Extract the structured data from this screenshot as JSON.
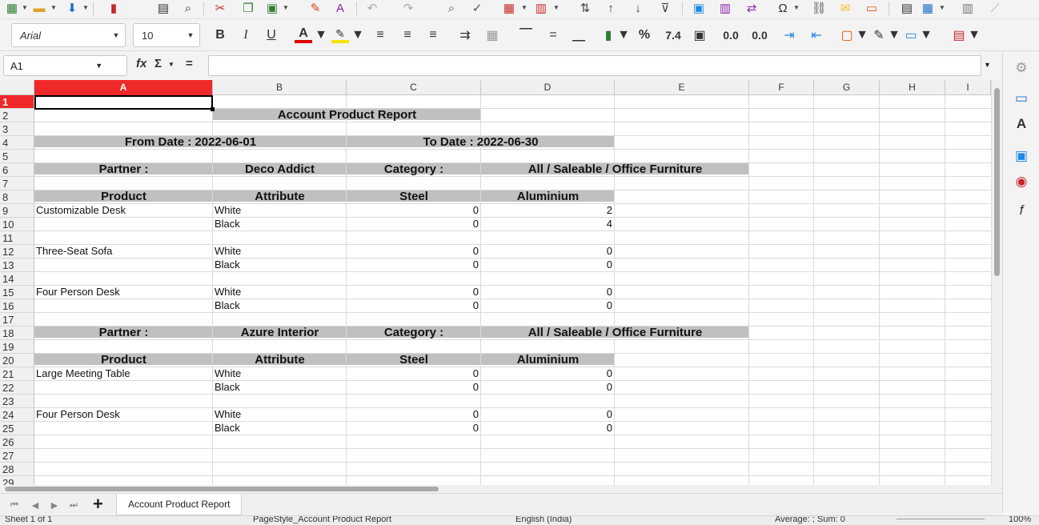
{
  "toolbar": {
    "font_name": "Arial",
    "font_size": "10",
    "bold": "B",
    "italic": "I",
    "underline": "U",
    "percent": "%",
    "number": "7.4",
    "add_decimal": "0.0",
    "del_decimal": "0.0",
    "special_char": "Ω"
  },
  "formula_bar": {
    "cell_ref": "A1",
    "fx": "fx",
    "sum": "Σ",
    "equals": "=",
    "value": ""
  },
  "columns": [
    "A",
    "B",
    "C",
    "D",
    "E",
    "F",
    "G",
    "H",
    "I"
  ],
  "rows": [
    "1",
    "2",
    "3",
    "4",
    "5",
    "6",
    "7",
    "8",
    "9",
    "10",
    "11",
    "12",
    "13",
    "14",
    "15",
    "16",
    "17",
    "18",
    "19",
    "20",
    "21",
    "22",
    "23",
    "24",
    "25",
    "26",
    "27",
    "28",
    "29"
  ],
  "report": {
    "title": "Account Product Report",
    "from_date": "From Date : 2022-06-01",
    "to_date": "To Date : 2022-06-30",
    "partner_label": "Partner :",
    "category_label": "Category :",
    "product_header": "Product",
    "attribute_header": "Attribute",
    "steel_header": "Steel",
    "aluminium_header": "Aluminium",
    "sections": [
      {
        "partner": "Deco Addict",
        "category": "All / Saleable / Office Furniture",
        "items": [
          {
            "product": "Customizable Desk",
            "white": "White",
            "black": "Black",
            "w_steel": "0",
            "w_alu": "2",
            "b_steel": "0",
            "b_alu": "4"
          },
          {
            "product": "Three-Seat Sofa",
            "white": "White",
            "black": "Black",
            "w_steel": "0",
            "w_alu": "0",
            "b_steel": "0",
            "b_alu": "0"
          },
          {
            "product": "Four Person Desk",
            "white": "White",
            "black": "Black",
            "w_steel": "0",
            "w_alu": "0",
            "b_steel": "0",
            "b_alu": "0"
          }
        ]
      },
      {
        "partner": "Azure Interior",
        "category": "All / Saleable / Office Furniture",
        "items": [
          {
            "product": "Large Meeting Table",
            "white": "White",
            "black": "Black",
            "w_steel": "0",
            "w_alu": "0",
            "b_steel": "0",
            "b_alu": "0"
          },
          {
            "product": "Four Person Desk",
            "white": "White",
            "black": "Black",
            "w_steel": "0",
            "w_alu": "0",
            "b_steel": "0",
            "b_alu": "0"
          }
        ]
      }
    ]
  },
  "tabs": {
    "add": "+",
    "sheet_name": "Account Product Report"
  },
  "status": {
    "sheet": "Sheet 1 of 1",
    "page_style": "PageStyle_Account Product Report",
    "language": "English (India)",
    "stats": "Average: ; Sum: 0",
    "zoom": "100%"
  },
  "colors": {
    "selection_header": "#ef2929",
    "band_gray": "#c0c0c0"
  }
}
